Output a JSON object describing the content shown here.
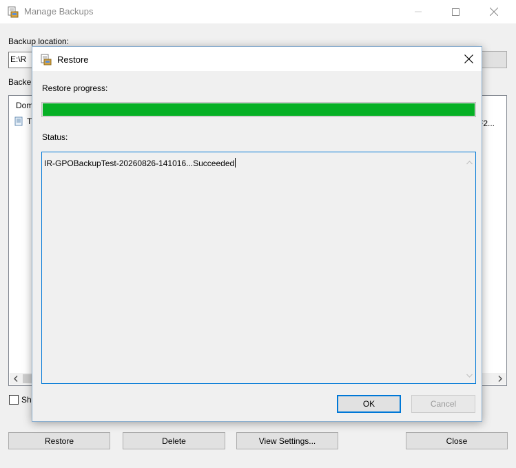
{
  "main": {
    "title": "Manage Backups",
    "backup_location_label": "Backup location:",
    "backup_location_value": "E:\\R",
    "backed_up_label": "Backe",
    "list_header": "Dom",
    "list_row_fragment": "T",
    "list_row_right_fragment": "F2...",
    "show_checkbox_label": "Sh",
    "buttons": {
      "restore": "Restore",
      "delete": "Delete",
      "view_settings": "View Settings...",
      "close": "Close"
    }
  },
  "dialog": {
    "title": "Restore",
    "progress_label": "Restore progress:",
    "progress_percent": 100,
    "status_label": "Status:",
    "status_text": "IR-GPOBackupTest-20260826-141016...Succeeded",
    "ok_label": "OK",
    "cancel_label": "Cancel"
  },
  "colors": {
    "progress_fill": "#06b025",
    "focus_accent": "#0078d7"
  },
  "icons": {
    "window": "backup-icon",
    "row": "gpo-backup-icon"
  }
}
